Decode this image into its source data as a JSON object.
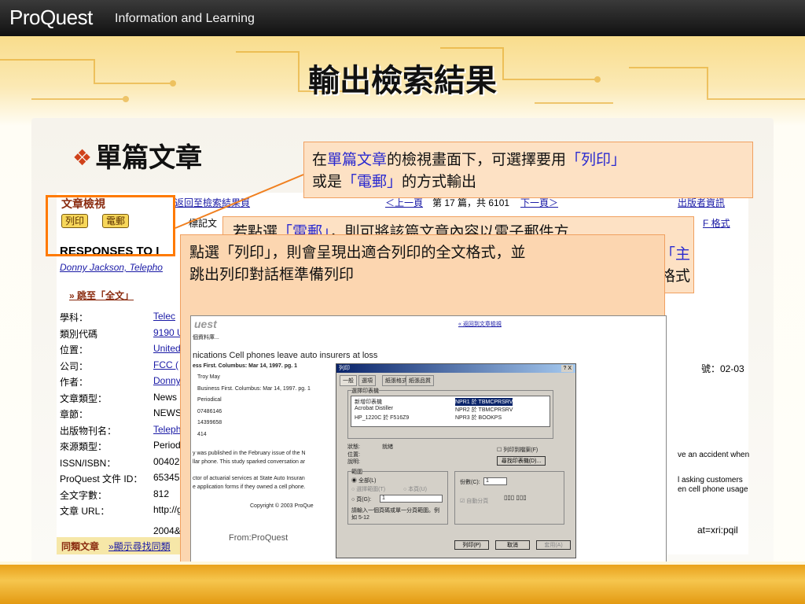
{
  "brand": {
    "logo": "ProQuest",
    "tagline": "Information and Learning"
  },
  "slide": {
    "title": "輸出檢索結果",
    "bullet_mark": "❖",
    "bullet": "單篇文章"
  },
  "callout_top": {
    "p1": "在",
    "b1": "單篇文章",
    "p2": "的檢視畫面下，可選擇要用",
    "b2": "「列印」",
    "p3": "或是",
    "b3": "「電郵」",
    "p4": "的方式輸出"
  },
  "callout_email": {
    "p1": "若點選",
    "b1": "「電郵」",
    "p2": "，則可將該篇文章內容以電子郵件方",
    "b2": "「主",
    "p3": "格式"
  },
  "callout_print": {
    "line1": "點選「列印」，則會呈現出適合列印的全文格式，並",
    "line2": "跳出列印對話框準備列印"
  },
  "web": {
    "header": "文章檢視",
    "back_link": "返回至檢索結果頁",
    "print_btn": "列印",
    "email_btn": "電郵",
    "mark_label": "標記文",
    "nav": {
      "prev": "＜上一頁",
      "pos": "第 17 篇，共 6101",
      "next": "下一頁＞"
    },
    "publisher_link": "出版者資訊",
    "format_link": "F 格式",
    "article_title": "RESPONSES TO I",
    "author_links": "Donny Jackson, Telepho",
    "jump": "» 跳至「全文」",
    "fields": [
      {
        "label": "學科：",
        "value": "Telec"
      },
      {
        "label": "類別代碼",
        "value": "9190 U"
      },
      {
        "label": "位置：",
        "value": "United"
      },
      {
        "label": "公司：",
        "value": "FCC ("
      },
      {
        "label": "作者：",
        "value": "Donny"
      },
      {
        "label": "文章類型：",
        "value": "News"
      },
      {
        "label": "章節：",
        "value": "NEWS"
      },
      {
        "label": "出版物刊名：",
        "value": "Teleph"
      },
      {
        "label": "來源類型：",
        "value": "Period"
      },
      {
        "label": "ISSN/ISBN：",
        "value": "00402"
      },
      {
        "label": "ProQuest 文件 ID：",
        "value": "65345"
      },
      {
        "label": "全文字數：",
        "value": "812"
      },
      {
        "label": "文章 URL：",
        "value": "http://g"
      }
    ],
    "url_cont": "2004&",
    "right_date": "號：02-03",
    "right_url": "at=xri:pqil",
    "similar_label": "同類文章",
    "similar_link": "»顯示尋找同類",
    "right_frag1": "ve an accident when",
    "right_frag2": "l asking customers",
    "right_frag3": "en cell phone usage"
  },
  "printview": {
    "logo": "uest",
    "back": "« 返回到文章檢視",
    "db": "個資料庫...",
    "headline": "nications Cell phones leave auto insurers at loss",
    "source": "ess First. Columbus: Mar 14, 1997.  pg. 1",
    "meta": [
      "Troy May",
      "Business First. Columbus: Mar 14, 1997.  pg. 1",
      "Periodical",
      "07486146",
      "14399658",
      "414"
    ],
    "body1": "y was published in the February issue of the N",
    "body2": "llar phone. This study sparked conversation ar",
    "body3": "ctor of actuarial services at State Auto Insuran",
    "body4": "e application forms if they owned a cell phone.",
    "copyright": "Copyright © 2003 ProQue",
    "footer_logo": "From:ProQuest"
  },
  "dialog": {
    "title": "列印",
    "help": "? X",
    "tabs": [
      "一般",
      "選項",
      "紙張格式",
      "紙張品質"
    ],
    "select_group": "選擇印表機",
    "printers": [
      "新增印表機",
      "Acrobat Distiller",
      "HP_1220C 於 F516Z9",
      "NPR1 於 TBMCPRSRV",
      "NPR2 於 TBMCPRSRV",
      "NPR3 於 BOOKPS"
    ],
    "status_label": "狀態:",
    "status_value": "就緒",
    "location_label": "位置:",
    "comment_label": "說明:",
    "print_to_file": "列印到檔案(F)",
    "find_printer": "尋找印表機(D)...",
    "range_group": "範圍",
    "all": "全部(L)",
    "selection": "選擇範圍(T)",
    "current": "本頁(U)",
    "pages": "頁(G):",
    "pages_value": "1",
    "hint": "請輸入一個頁碼或單一分頁範圍。例如 5-12",
    "copies": "份數(C):",
    "copies_value": "1",
    "collate": "自動分頁",
    "btn_print": "列印(P)",
    "btn_cancel": "取消",
    "btn_apply": "套用(A)"
  }
}
